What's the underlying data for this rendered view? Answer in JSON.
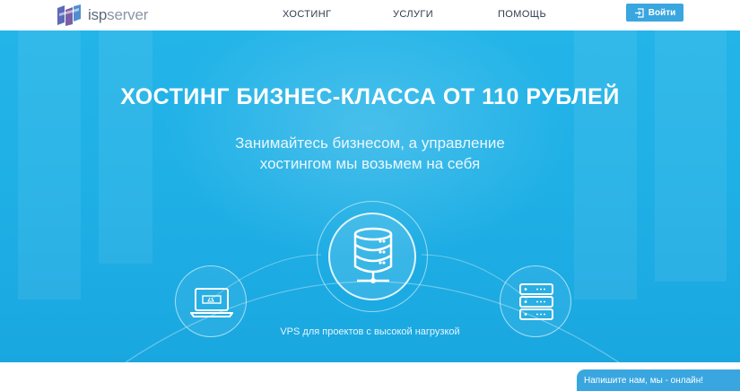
{
  "logo": {
    "text_isp": "isp",
    "text_server": "server"
  },
  "nav": {
    "hosting": "ХОСТИНГ",
    "services": "УСЛУГИ",
    "help": "ПОМОЩЬ"
  },
  "login": {
    "label": "Войти"
  },
  "hero": {
    "title": "ХОСТИНГ БИЗНЕС-КЛАССА ОТ 110 РУБЛЕЙ",
    "subtitle_line1": "Занимайтесь бизнесом, а управление",
    "subtitle_line2": "хостингом мы возьмем на себя",
    "caption": "VPS для проектов с высокой нагрузкой"
  },
  "chat": {
    "label": "Напишите нам, мы - онлайн!"
  },
  "colors": {
    "accent": "#3aa6e0",
    "hero_bg": "#1fb0e6",
    "text_dark": "#2f3c4a"
  }
}
